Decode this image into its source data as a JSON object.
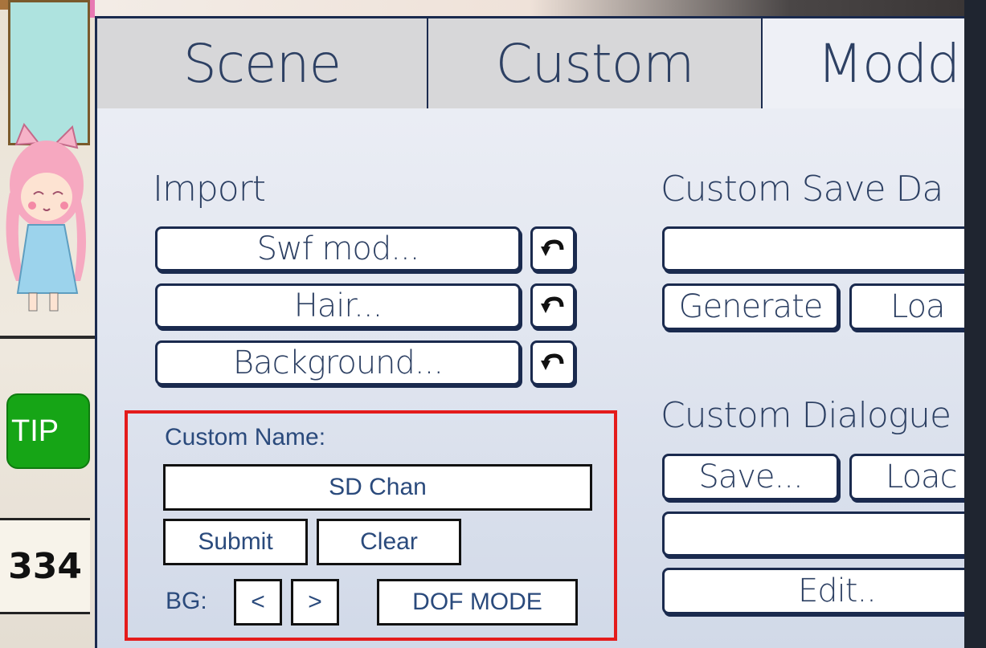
{
  "tabs": [
    {
      "label": "Scene"
    },
    {
      "label": "Custom"
    },
    {
      "label": "Modd"
    }
  ],
  "import": {
    "title": "Import",
    "buttons": [
      {
        "label": "Swf mod..."
      },
      {
        "label": "Hair..."
      },
      {
        "label": "Background..."
      }
    ],
    "undo_icon": "undo-arrow-icon"
  },
  "custom_name": {
    "label": "Custom Name:",
    "value": "SD Chan",
    "submit_label": "Submit",
    "clear_label": "Clear",
    "bg_label": "BG:",
    "prev_label": "<",
    "next_label": ">",
    "dof_label": "DOF MODE"
  },
  "save_data": {
    "title": "Custom Save Da",
    "input_value": "",
    "generate_label": "Generate",
    "load_label": "Loa"
  },
  "dialogue": {
    "title": "Custom Dialogue",
    "save_label": "Save...",
    "load_label": "Loac",
    "input_value": "",
    "edit_label": "Edit.."
  },
  "side": {
    "tip_label": "TIP",
    "counter": "334"
  },
  "colors": {
    "highlight": "#e41b1b",
    "text_primary": "#2d4063",
    "tip_green": "#16a516"
  }
}
